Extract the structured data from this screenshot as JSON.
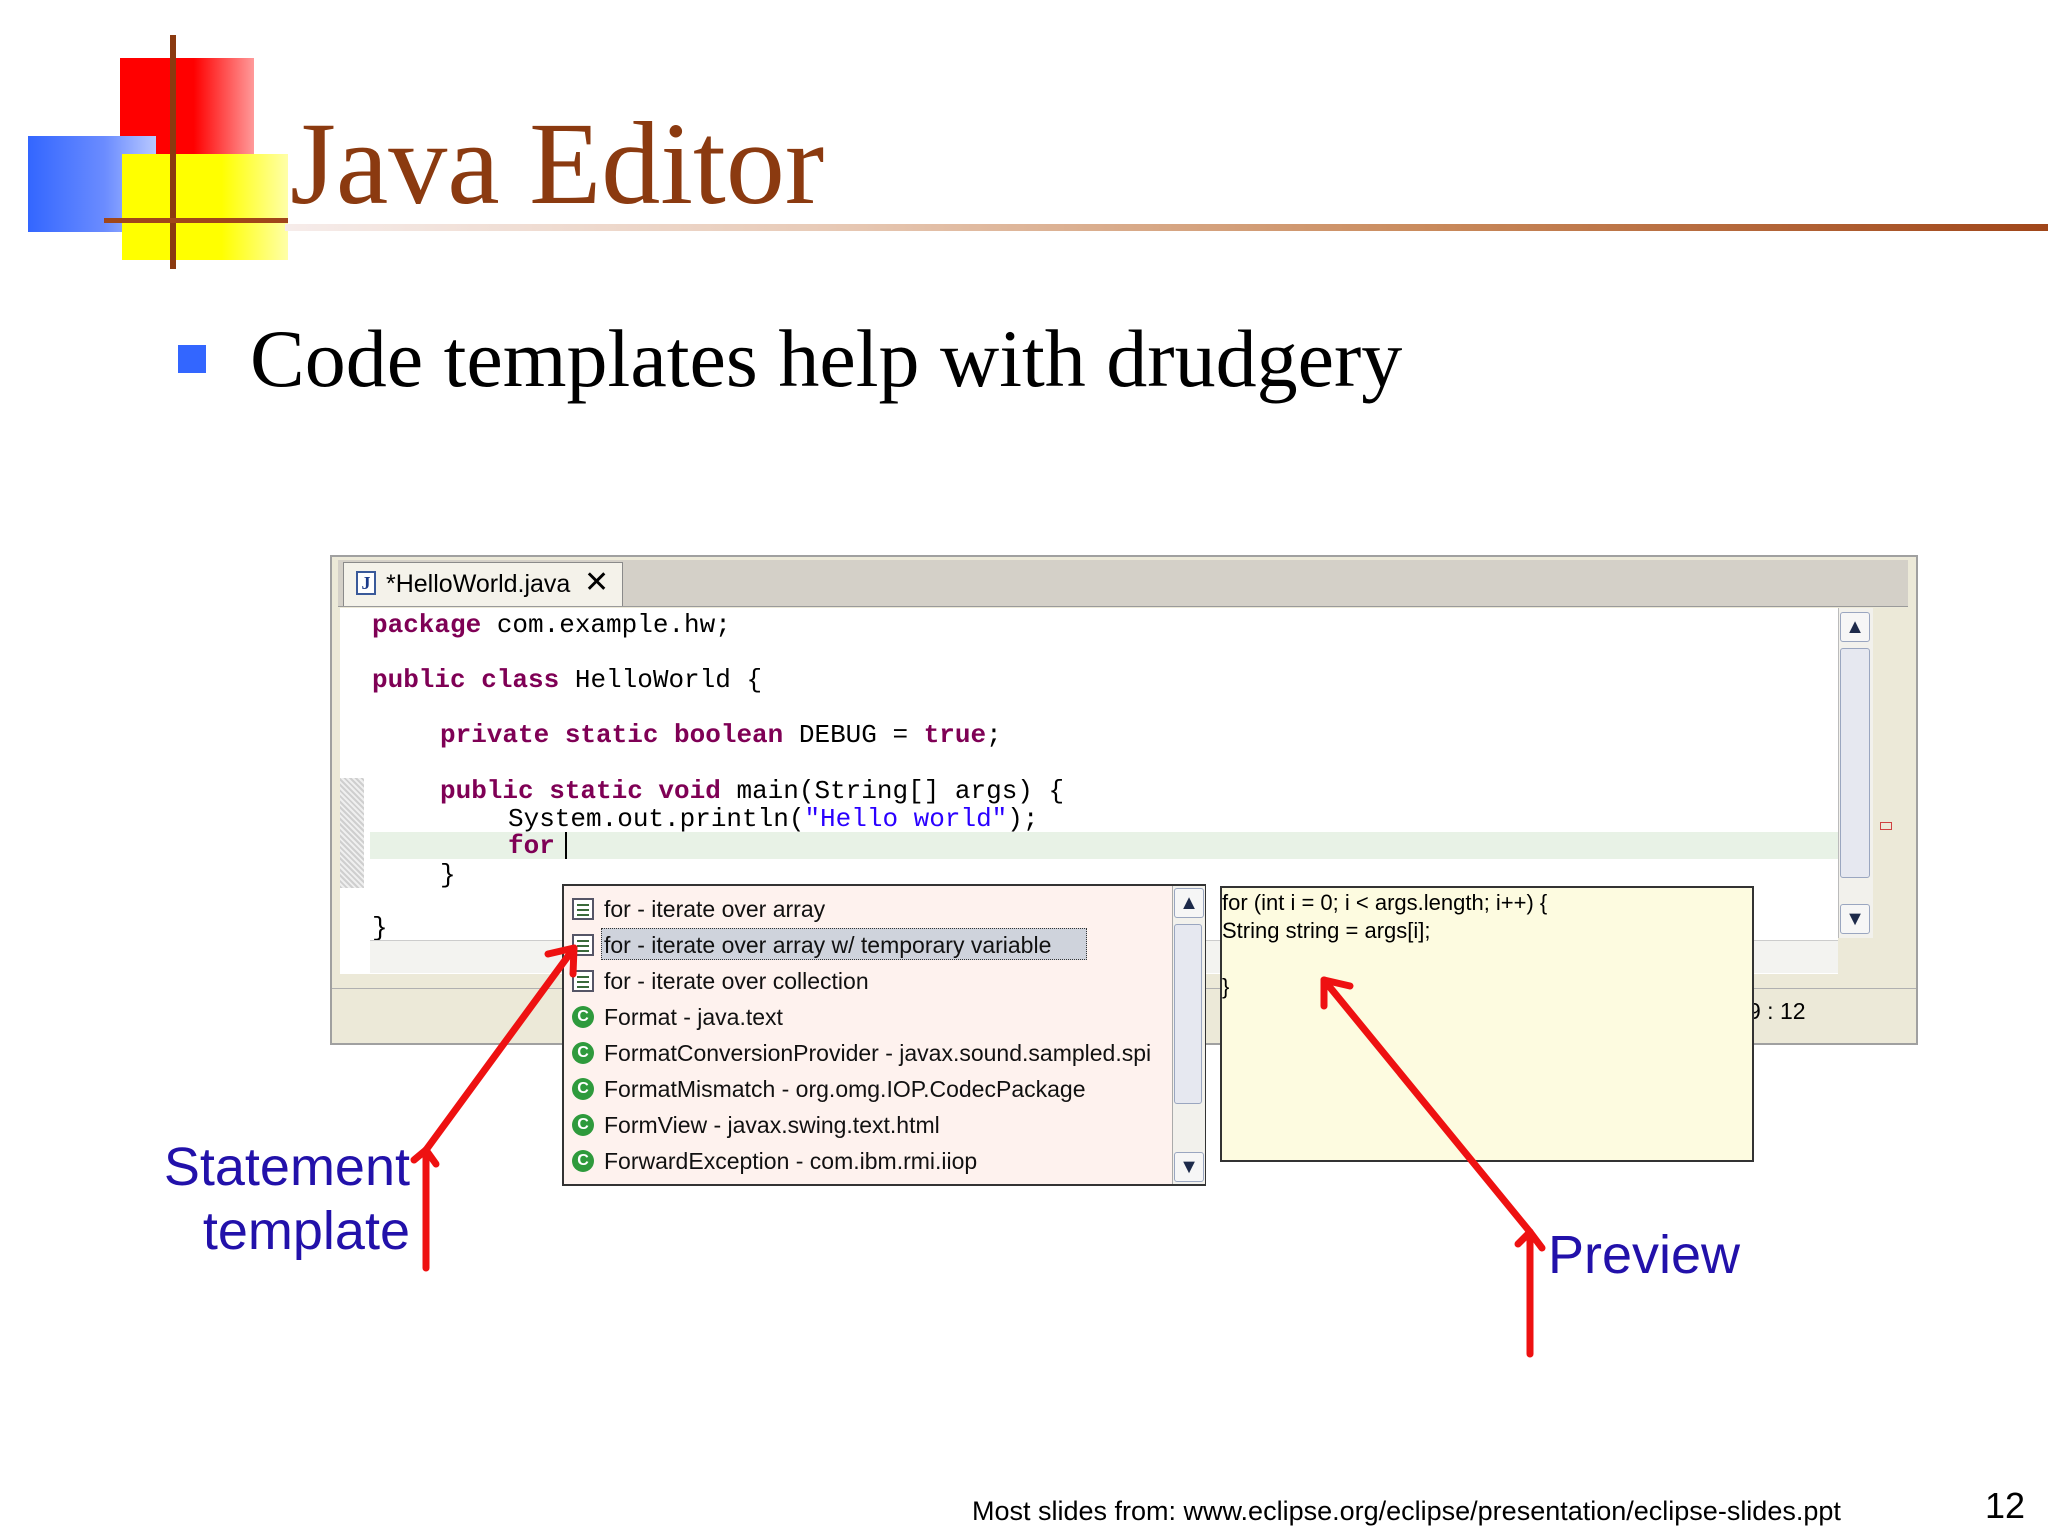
{
  "slide": {
    "title": "Java Editor",
    "bullet": "Code templates help with drudgery",
    "footer_source": "Most slides from: www.eclipse.org/eclipse/presentation/eclipse-slides.ppt",
    "page_number": "12"
  },
  "editor": {
    "tab_label": "*HelloWorld.java",
    "tab_close": "✕",
    "status_position": "9 : 12",
    "code": {
      "l1_kw": "package",
      "l1_rest": " com.example.hw;",
      "l2_kw": "public class",
      "l2_rest": " HelloWorld {",
      "l3_kw1": "private static boolean",
      "l3_mid": " DEBUG = ",
      "l3_kw2": "true",
      "l3_end": ";",
      "l4_kw": "public static void",
      "l4_rest": " main(String[] args) {",
      "l5_rest": "System.out.println(",
      "l5_str": "\"Hello world\"",
      "l5_end": ");",
      "l6_kw": "for",
      "l7": "}",
      "l8": "}"
    }
  },
  "content_assist": {
    "items": [
      {
        "icon": "template-icon",
        "label": "for - iterate over array"
      },
      {
        "icon": "template-icon",
        "label": "for - iterate over array w/ temporary variable"
      },
      {
        "icon": "template-icon",
        "label": "for - iterate over collection"
      },
      {
        "icon": "class-icon",
        "label": "Format - java.text"
      },
      {
        "icon": "class-icon",
        "label": "FormatConversionProvider - javax.sound.sampled.spi"
      },
      {
        "icon": "class-icon",
        "label": "FormatMismatch - org.omg.IOP.CodecPackage"
      },
      {
        "icon": "class-icon",
        "label": "FormView - javax.swing.text.html"
      },
      {
        "icon": "class-icon",
        "label": "ForwardException - com.ibm.rmi.iiop"
      }
    ],
    "selected_index": 1
  },
  "preview": {
    "lines": [
      "for (int i = 0; i < args.length; i++) {",
      "String string = args[i];",
      "",
      "}"
    ]
  },
  "annotations": {
    "statement_template_line1": "Statement",
    "statement_template_line2": "template",
    "preview": "Preview"
  },
  "colors": {
    "title": "#8b3a10",
    "bullet": "#3366ff",
    "annotation_text": "#2211aa",
    "arrow": "#ee1111",
    "keyword": "#7f0055",
    "string": "#2a00ff"
  }
}
